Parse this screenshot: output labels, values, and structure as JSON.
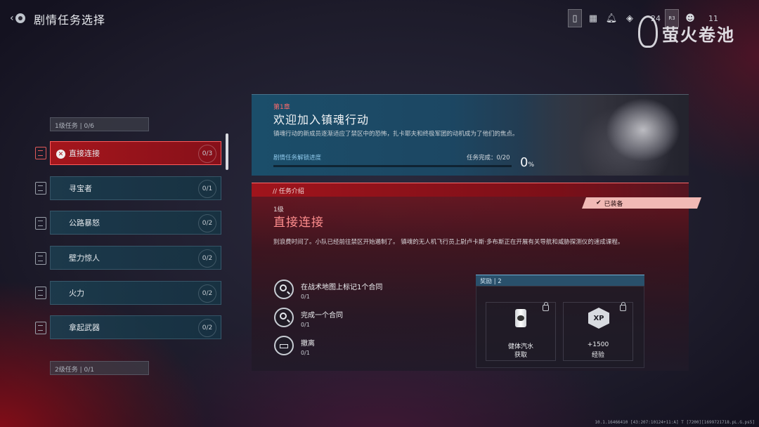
{
  "header": {
    "title": "剧情任务选择",
    "counts": [
      "24",
      "11"
    ],
    "icons": [
      "back-icon",
      "controller-icon",
      "grid-icon",
      "notification-bell-icon",
      "rank-icon",
      "r3-icon",
      "squad-icon"
    ],
    "watermark": "萤火卷池"
  },
  "mission_list": {
    "group1_label": "1级任务 | 0/6",
    "group2_label": "2级任务 | 0/1",
    "items": [
      {
        "name": "直接连接",
        "count": "0/3",
        "active": true
      },
      {
        "name": "寻宝者",
        "count": "0/1",
        "active": false
      },
      {
        "name": "公路暴怒",
        "count": "0/2",
        "active": false
      },
      {
        "name": "壁力惊人",
        "count": "0/2",
        "active": false
      },
      {
        "name": "火力",
        "count": "0/2",
        "active": false
      },
      {
        "name": "拿起武器",
        "count": "0/2",
        "active": false
      }
    ]
  },
  "chapter": {
    "tag": "第1章",
    "title": "欢迎加入镇魂行动",
    "description": "镇魂行动的新成员逐渐适应了禁区中的恐怖，扎卡耶夫和终极军团的动机成为了他们的焦点。",
    "progress_label": "剧情任务解锁进度",
    "progress_count": "任务完成：0/20",
    "progress_value": 0,
    "progress_pct": "0",
    "progress_unit": "%"
  },
  "intro": {
    "header": "// 任务介绍",
    "equipped": "已装备",
    "level": "1级",
    "title": "直接连接",
    "description": "别浪费时间了。小队已经前往禁区开始遏制了。 镇魂的无人机飞行员上尉卢卡斯·多布斯正在开展有关导航和威胁探测仪的速成课程。",
    "objectives": [
      {
        "name": "在战术地图上标记1个合同",
        "progress": "0/1",
        "icon": "magnifier-icon"
      },
      {
        "name": "完成一个合同",
        "progress": "0/1",
        "icon": "magnifier-icon"
      },
      {
        "name": "撤离",
        "progress": "0/1",
        "icon": "exfil-icon"
      }
    ]
  },
  "rewards": {
    "header": "奖励 | 2",
    "items": [
      {
        "line1": "健体汽水",
        "line2": "获取",
        "icon": "soda-can-icon"
      },
      {
        "line1": "+1500",
        "line2": "经验",
        "icon": "xp-icon"
      }
    ],
    "xp_badge": "XP"
  },
  "build_string": "10.1.16466410 [43:207:10124+11:A] T [7200][1699721718.pL.G.ps5]"
}
